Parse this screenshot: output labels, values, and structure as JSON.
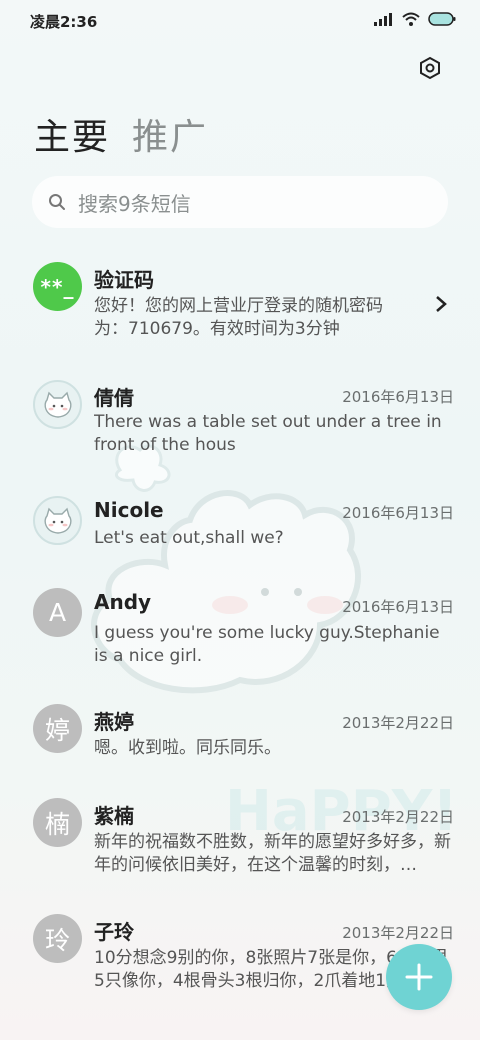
{
  "status_bar": {
    "time": "凌晨2:36"
  },
  "header": {
    "settings_icon": "settings-hexagon-icon",
    "tabs": [
      {
        "label": "主要",
        "active": true
      },
      {
        "label": "推广",
        "active": false
      }
    ]
  },
  "search": {
    "placeholder": "搜索9条短信"
  },
  "conversations": [
    {
      "sender": "验证码",
      "avatar_text": "**_",
      "avatar_type": "green",
      "date": "",
      "preview": "您好！您的网上营业厅登录的随机密码为：710679。有效时间为3分钟",
      "has_chevron": true
    },
    {
      "sender": "倩倩",
      "avatar_text": "",
      "avatar_type": "bear",
      "date": "2016年6月13日",
      "preview": "There was a table set out under a tree in front of the hous"
    },
    {
      "sender": "Nicole",
      "avatar_text": "",
      "avatar_type": "bear",
      "date": "2016年6月13日",
      "preview": "Let's eat out,shall we?"
    },
    {
      "sender": "Andy",
      "avatar_text": "A",
      "avatar_type": "letter",
      "date": "2016年6月13日",
      "preview": "I guess you're some lucky guy.Stephanie is a nice girl."
    },
    {
      "sender": "燕婷",
      "avatar_text": "婷",
      "avatar_type": "letter",
      "date": "2013年2月22日",
      "preview": "嗯。收到啦。同乐同乐。"
    },
    {
      "sender": "紫楠",
      "avatar_text": "楠",
      "avatar_type": "letter",
      "date": "2013年2月22日",
      "preview": "新年的祝福数不胜数，新年的愿望好多好多，新年的问候依旧美好，在这个温馨的时刻，…"
    },
    {
      "sender": "子玲",
      "avatar_text": "玲",
      "avatar_type": "letter",
      "date": "2013年2月22日",
      "preview": "10分想念9别的你，8张照片7张是你，6个梦里5只像你，4根骨头3根归你，2爪着地1只属于你。"
    }
  ],
  "fab": {
    "icon": "plus-icon",
    "color": "#6fd3d3"
  },
  "colors": {
    "accent": "#6fd3d3",
    "verification_avatar": "#4fc94a",
    "letter_avatar": "#bdbdbd"
  }
}
